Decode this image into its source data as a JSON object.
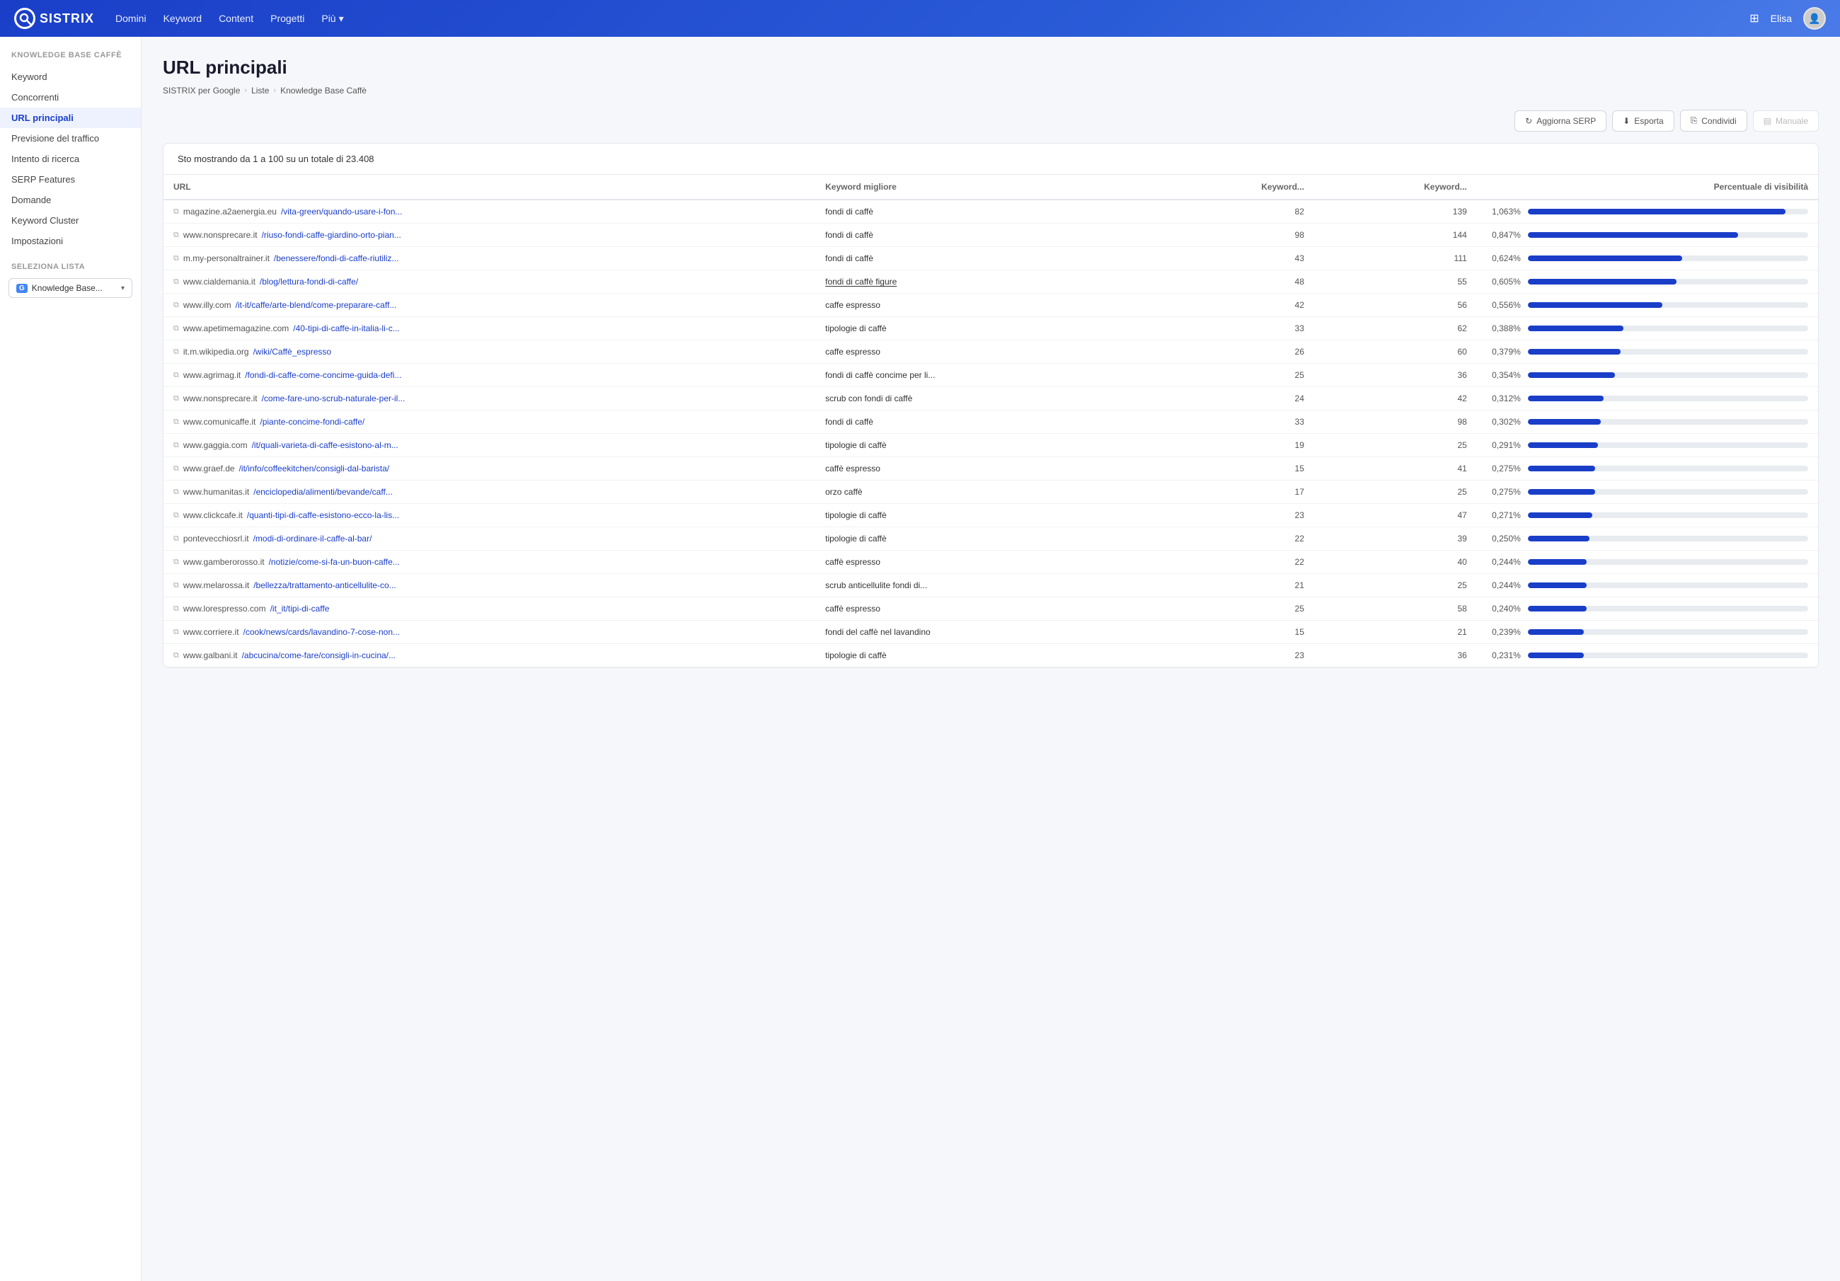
{
  "header": {
    "logo_text": "SISTRIX",
    "nav_items": [
      "Domini",
      "Keyword",
      "Content",
      "Progetti",
      "Più"
    ],
    "user_name": "Elisa"
  },
  "sidebar": {
    "section_title": "KNOWLEDGE BASE CAFFÈ",
    "items": [
      {
        "label": "Keyword",
        "active": false
      },
      {
        "label": "Concorrenti",
        "active": false
      },
      {
        "label": "URL principali",
        "active": true
      },
      {
        "label": "Previsione del traffico",
        "active": false
      },
      {
        "label": "Intento di ricerca",
        "active": false
      },
      {
        "label": "SERP Features",
        "active": false
      },
      {
        "label": "Domande",
        "active": false
      },
      {
        "label": "Keyword Cluster",
        "active": false
      },
      {
        "label": "Impostazioni",
        "active": false
      }
    ],
    "select_section_title": "SELEZIONA LISTA",
    "select_value": "Knowledge Base..."
  },
  "breadcrumb": {
    "items": [
      "SISTRIX per Google",
      "Liste",
      "Knowledge Base Caffè"
    ]
  },
  "page": {
    "title": "URL principali",
    "total_info": "Sto mostrando da 1 a 100 su un totale di 23.408"
  },
  "toolbar": {
    "aggiorna_serp": "Aggiorna SERP",
    "esporta": "Esporta",
    "condividi": "Condividi",
    "manuale": "Manuale"
  },
  "table": {
    "columns": [
      "URL",
      "Keyword migliore",
      "Keyword...",
      "Keyword...",
      "Percentuale di visibilità"
    ],
    "rows": [
      {
        "url_domain": "magazine.a2aenergia.eu",
        "url_path": "/vita-green/quando-usare-i-fon...",
        "keyword_best": "fondi di caffè",
        "kw1": "82",
        "kw2": "139",
        "vis_pct": "1,063%",
        "vis_bar": 92
      },
      {
        "url_domain": "www.nonsprecare.it",
        "url_path": "/riuso-fondi-caffe-giardino-orto-pian...",
        "keyword_best": "fondi di caffè",
        "kw1": "98",
        "kw2": "144",
        "vis_pct": "0,847%",
        "vis_bar": 75
      },
      {
        "url_domain": "m.my-personaltrainer.it",
        "url_path": "/benessere/fondi-di-caffe-riutiliz...",
        "keyword_best": "fondi di caffè",
        "kw1": "43",
        "kw2": "111",
        "vis_pct": "0,624%",
        "vis_bar": 55
      },
      {
        "url_domain": "www.cialdemania.it",
        "url_path": "/blog/lettura-fondi-di-caffe/",
        "keyword_best": "fondi di caffè figure",
        "keyword_underline": true,
        "kw1": "48",
        "kw2": "55",
        "vis_pct": "0,605%",
        "vis_bar": 53
      },
      {
        "url_domain": "www.illy.com",
        "url_path": "/it-it/caffe/arte-blend/come-preparare-caff...",
        "keyword_best": "caffe espresso",
        "kw1": "42",
        "kw2": "56",
        "vis_pct": "0,556%",
        "vis_bar": 48
      },
      {
        "url_domain": "www.apetimemagazine.com",
        "url_path": "/40-tipi-di-caffe-in-italia-li-c...",
        "keyword_best": "tipologie di caffè",
        "kw1": "33",
        "kw2": "62",
        "vis_pct": "0,388%",
        "vis_bar": 34
      },
      {
        "url_domain": "it.m.wikipedia.org",
        "url_path": "/wiki/Caffè_espresso",
        "keyword_best": "caffe espresso",
        "kw1": "26",
        "kw2": "60",
        "vis_pct": "0,379%",
        "vis_bar": 33
      },
      {
        "url_domain": "www.agrimag.it",
        "url_path": "/fondi-di-caffe-come-concime-guida-defi...",
        "keyword_best": "fondi di caffè concime per li...",
        "kw1": "25",
        "kw2": "36",
        "vis_pct": "0,354%",
        "vis_bar": 31
      },
      {
        "url_domain": "www.nonsprecare.it",
        "url_path": "/come-fare-uno-scrub-naturale-per-il...",
        "keyword_best": "scrub con fondi di caffè",
        "kw1": "24",
        "kw2": "42",
        "vis_pct": "0,312%",
        "vis_bar": 27
      },
      {
        "url_domain": "www.comunicaffe.it",
        "url_path": "/piante-concime-fondi-caffe/",
        "keyword_best": "fondi di caffè",
        "kw1": "33",
        "kw2": "98",
        "vis_pct": "0,302%",
        "vis_bar": 26
      },
      {
        "url_domain": "www.gaggia.com",
        "url_path": "/it/quali-varieta-di-caffe-esistono-al-m...",
        "keyword_best": "tipologie di caffè",
        "kw1": "19",
        "kw2": "25",
        "vis_pct": "0,291%",
        "vis_bar": 25
      },
      {
        "url_domain": "www.graef.de",
        "url_path": "/it/info/coffeekitchen/consigli-dal-barista/",
        "keyword_best": "caffè espresso",
        "kw1": "15",
        "kw2": "41",
        "vis_pct": "0,275%",
        "vis_bar": 24
      },
      {
        "url_domain": "www.humanitas.it",
        "url_path": "/enciclopedia/alimenti/bevande/caff...",
        "keyword_best": "orzo caffè",
        "kw1": "17",
        "kw2": "25",
        "vis_pct": "0,275%",
        "vis_bar": 24
      },
      {
        "url_domain": "www.clickcafe.it",
        "url_path": "/quanti-tipi-di-caffe-esistono-ecco-la-lis...",
        "keyword_best": "tipologie di caffè",
        "kw1": "23",
        "kw2": "47",
        "vis_pct": "0,271%",
        "vis_bar": 23
      },
      {
        "url_domain": "pontevecchiosrl.it",
        "url_path": "/modi-di-ordinare-il-caffe-al-bar/",
        "keyword_best": "tipologie di caffè",
        "kw1": "22",
        "kw2": "39",
        "vis_pct": "0,250%",
        "vis_bar": 22
      },
      {
        "url_domain": "www.gamberorosso.it",
        "url_path": "/notizie/come-si-fa-un-buon-caffe...",
        "keyword_best": "caffè espresso",
        "kw1": "22",
        "kw2": "40",
        "vis_pct": "0,244%",
        "vis_bar": 21
      },
      {
        "url_domain": "www.melarossa.it",
        "url_path": "/bellezza/trattamento-anticellulite-co...",
        "keyword_best": "scrub anticellulite fondi di...",
        "kw1": "21",
        "kw2": "25",
        "vis_pct": "0,244%",
        "vis_bar": 21
      },
      {
        "url_domain": "www.lorespresso.com",
        "url_path": "/it_it/tipi-di-caffe",
        "keyword_best": "caffè espresso",
        "kw1": "25",
        "kw2": "58",
        "vis_pct": "0,240%",
        "vis_bar": 21
      },
      {
        "url_domain": "www.corriere.it",
        "url_path": "/cook/news/cards/lavandino-7-cose-non...",
        "keyword_best": "fondi del caffè nel lavandino",
        "kw1": "15",
        "kw2": "21",
        "vis_pct": "0,239%",
        "vis_bar": 20
      },
      {
        "url_domain": "www.galbani.it",
        "url_path": "/abcucina/come-fare/consigli-in-cucina/...",
        "keyword_best": "tipologie di caffè",
        "kw1": "23",
        "kw2": "36",
        "vis_pct": "0,231%",
        "vis_bar": 20
      }
    ]
  }
}
